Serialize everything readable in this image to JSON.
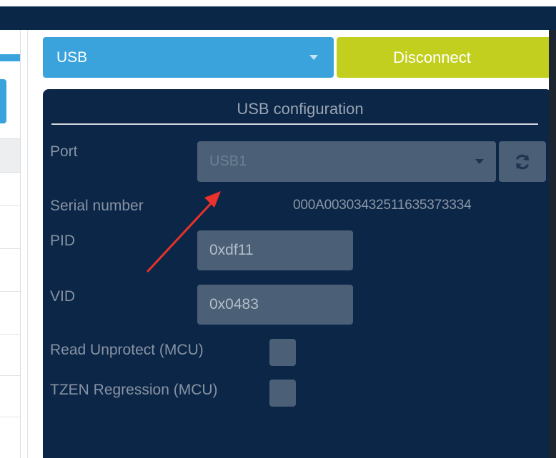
{
  "interface_select": {
    "value": "USB"
  },
  "connection": {
    "disconnect_label": "Disconnect"
  },
  "usb_config": {
    "title": "USB configuration",
    "port": {
      "label": "Port",
      "value": "USB1"
    },
    "serial_number": {
      "label": "Serial number",
      "value": "000A00303432511635373334"
    },
    "pid": {
      "label": "PID",
      "value": "0xdf11"
    },
    "vid": {
      "label": "VID",
      "value": "0x0483"
    },
    "read_unprotect": {
      "label": "Read Unprotect (MCU)",
      "checked": false
    },
    "tzen_regression": {
      "label": "TZEN Regression (MCU)",
      "checked": false
    }
  },
  "icons": {
    "refresh": "refresh-icon",
    "dropdown": "chevron-down-icon",
    "annotation": "red-arrow"
  },
  "colors": {
    "header_bg": "#0a2748",
    "panel_bg": "#0b2647",
    "interface_blue": "#3aa3dc",
    "disconnect_green": "#c3cf1e",
    "field_bg": "#4b5f76",
    "annotation_red": "#e8322b"
  }
}
